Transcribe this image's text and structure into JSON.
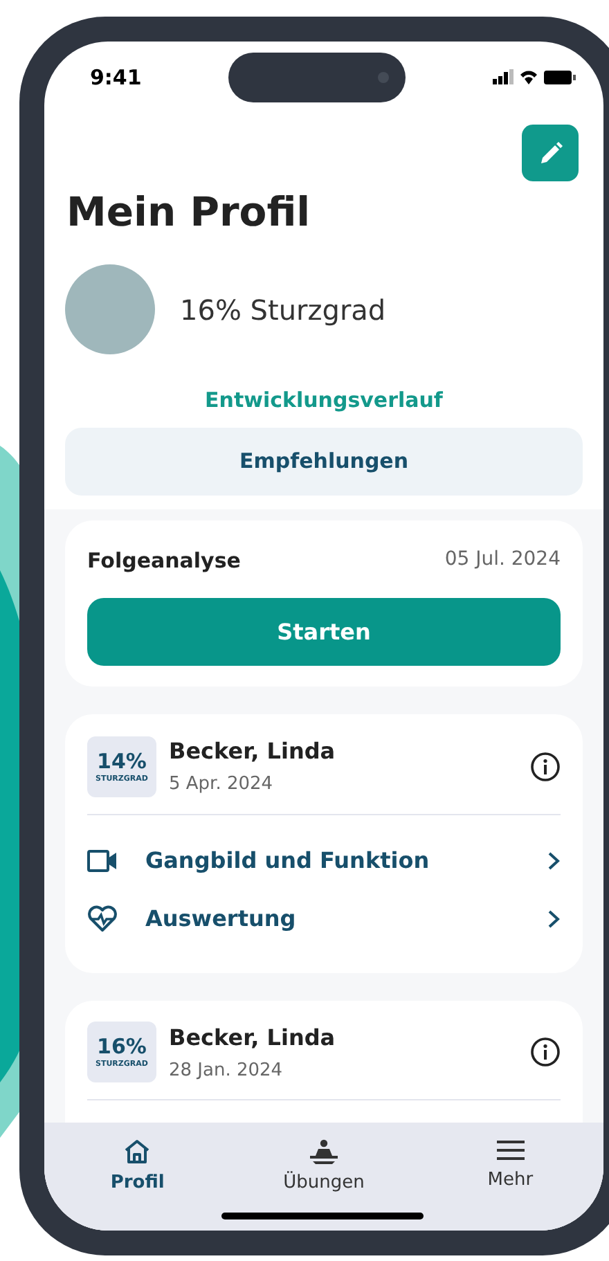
{
  "status_bar": {
    "time": "9:41"
  },
  "header": {
    "title": "Mein Profil"
  },
  "profile": {
    "fall_risk": "16% Sturzgrad"
  },
  "history_link": "Entwicklungsverlauf",
  "recommendations_button": "Empfehlungen",
  "follow_up": {
    "title": "Folgeanalyse",
    "date": "05 Jul. 2024",
    "button": "Starten"
  },
  "assessments": [
    {
      "percent": "14%",
      "label": "STURZGRAD",
      "name": "Becker, Linda",
      "date": "5 Apr. 2024",
      "links": [
        {
          "kind": "video",
          "label": "Gangbild und Funktion"
        },
        {
          "kind": "heart",
          "label": "Auswertung"
        }
      ]
    },
    {
      "percent": "16%",
      "label": "STURZGRAD",
      "name": "Becker, Linda",
      "date": "28 Jan. 2024"
    }
  ],
  "tab_bar": [
    {
      "kind": "home",
      "label": "Profil",
      "selected": true
    },
    {
      "kind": "exercise",
      "label": "Übungen",
      "selected": false
    },
    {
      "kind": "menu",
      "label": "Mehr",
      "selected": false
    }
  ]
}
